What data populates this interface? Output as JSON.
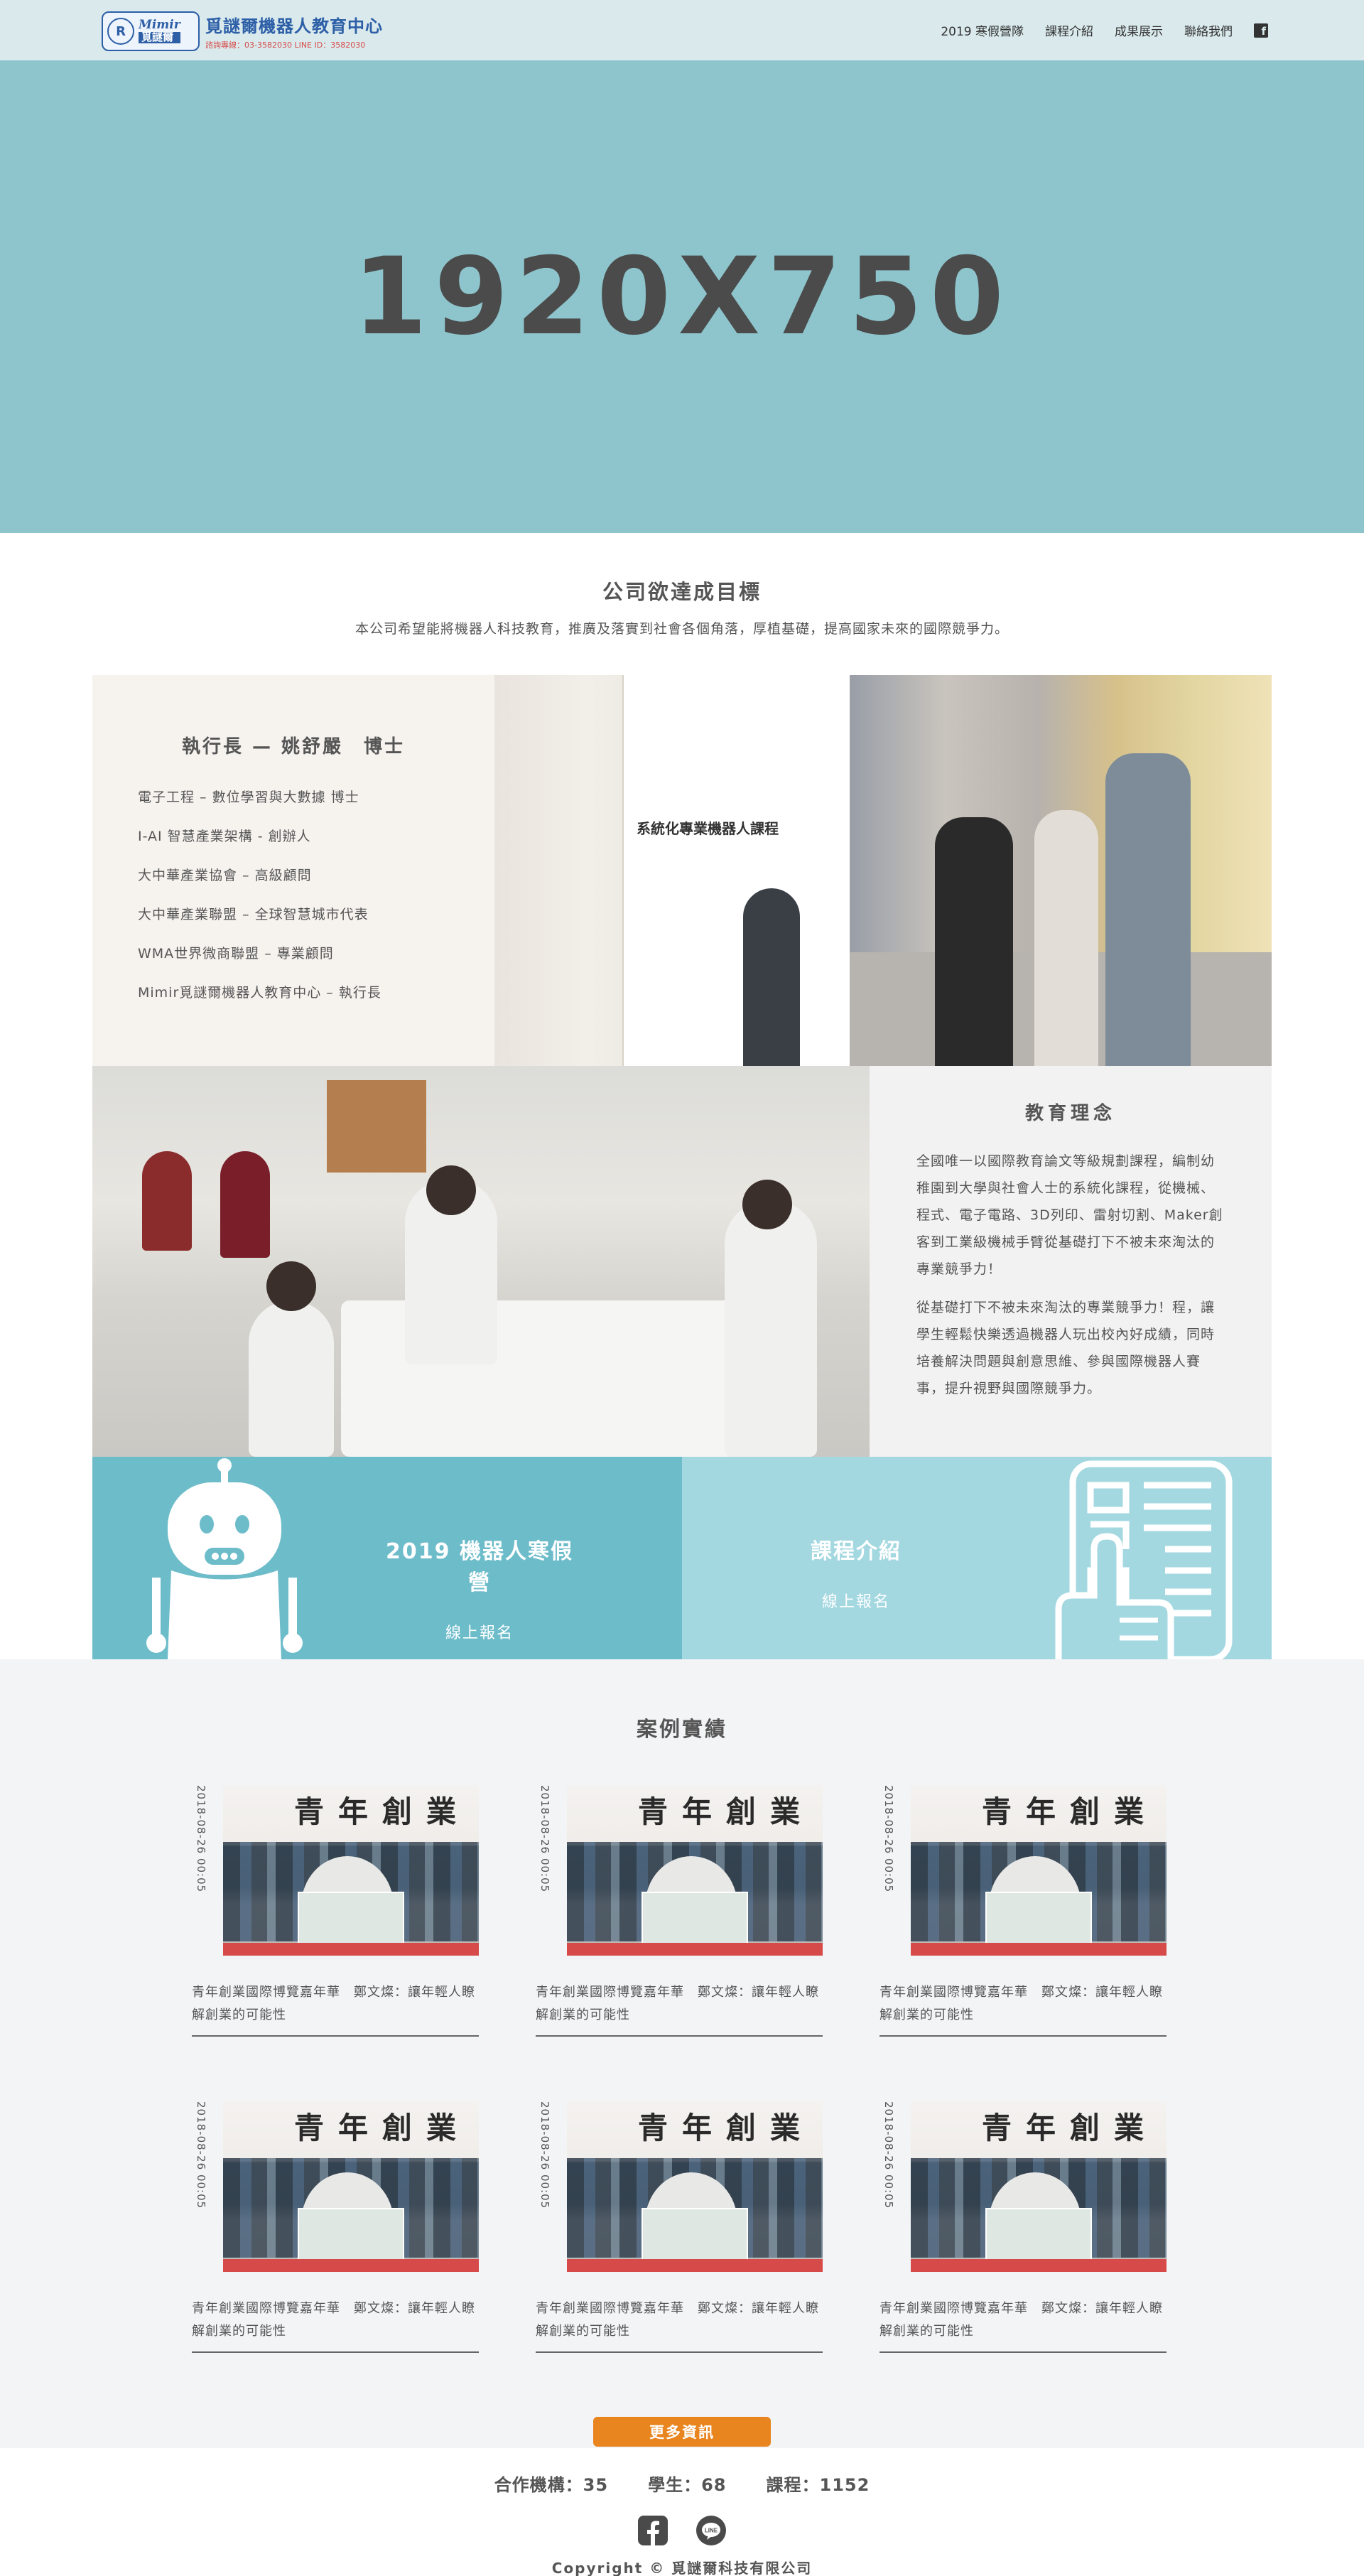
{
  "header": {
    "logo": {
      "en": "Mimir",
      "zh": "覓謎爾",
      "title": "覓謎爾機器人教育中心",
      "contact": "諮詢專線：03-3582030 LINE ID：3582030"
    },
    "nav": [
      {
        "label": "2019 寒假營隊"
      },
      {
        "label": "課程介紹"
      },
      {
        "label": "成果展示"
      },
      {
        "label": "聯絡我們"
      }
    ],
    "facebook_icon": "facebook-icon"
  },
  "hero": {
    "text": "1920X750"
  },
  "goal": {
    "title": "公司欲達成目標",
    "text": "本公司希望能將機器人科技教育，推廣及落實到社會各個角落，厚植基礎，提高國家未來的國際競爭力。"
  },
  "ceo": {
    "title": "執行長 — 姚舒嚴　博士",
    "items": [
      "電子工程 – 數位學習與大數據 博士",
      "I-AI 智慧產業架構 - 創辦人",
      "大中華產業協會 – 高級顧問",
      "大中華產業聯盟 – 全球智慧城市代表",
      "WMA世界微商聯盟 – 專業顧問",
      "Mimir覓謎爾機器人教育中心 – 執行長"
    ]
  },
  "expo_photo": {
    "sign_text": "系統化專業機器人課程"
  },
  "philosophy": {
    "title": "教育理念",
    "p1": "全國唯一以國際教育論文等級規劃課程，編制幼稚園到大學與社會人士的系統化課程，從機械、程式、電子電路、3D列印、雷射切割、Maker創客到工業級機械手臂從基礎打下不被未來淘汰的專業競爭力！",
    "p2": "從基礎打下不被未來淘汰的專業競爭力！程，讓學生輕鬆快樂透過機器人玩出校內好成績，同時培養解決問題與創意思維、參與國際機器人賽事，提升視野與國際競爭力。"
  },
  "promo": {
    "camp": {
      "title": "2019 機器人寒假營",
      "link": "線上報名",
      "icon": "robot-icon"
    },
    "course": {
      "title": "課程介紹",
      "link": "線上報名",
      "icon": "document-hand-icon"
    }
  },
  "cases": {
    "title": "案例實績",
    "items": [
      {
        "date": "2018-08-26 00:05",
        "title": "青年創業國際博覽嘉年華　鄭文燦：讓年輕人瞭解創業的可能性",
        "banner": "青年創業"
      },
      {
        "date": "2018-08-26 00:05",
        "title": "青年創業國際博覽嘉年華　鄭文燦：讓年輕人瞭解創業的可能性",
        "banner": "青年創業"
      },
      {
        "date": "2018-08-26 00:05",
        "title": "青年創業國際博覽嘉年華　鄭文燦：讓年輕人瞭解創業的可能性",
        "banner": "青年創業"
      },
      {
        "date": "2018-08-26 00:05",
        "title": "青年創業國際博覽嘉年華　鄭文燦：讓年輕人瞭解創業的可能性",
        "banner": "青年創業"
      },
      {
        "date": "2018-08-26 00:05",
        "title": "青年創業國際博覽嘉年華　鄭文燦：讓年輕人瞭解創業的可能性",
        "banner": "青年創業"
      },
      {
        "date": "2018-08-26 00:05",
        "title": "青年創業國際博覽嘉年華　鄭文燦：讓年輕人瞭解創業的可能性",
        "banner": "青年創業"
      }
    ],
    "more_button": "更多資訊"
  },
  "footer": {
    "stats": [
      "合作機構：35",
      "學生：68",
      "課程：1152"
    ],
    "social": [
      "facebook-icon",
      "line-icon"
    ],
    "copyright": "Copyright © 覓謎爾科技有限公司"
  },
  "colors": {
    "header_bg": "#d9e9ec",
    "hero_bg": "#8ec5cc",
    "promo_a": "#6dbcca",
    "promo_b": "#a4d8e1",
    "accent_button": "#e8851f",
    "brand_blue": "#2d5fa7"
  }
}
